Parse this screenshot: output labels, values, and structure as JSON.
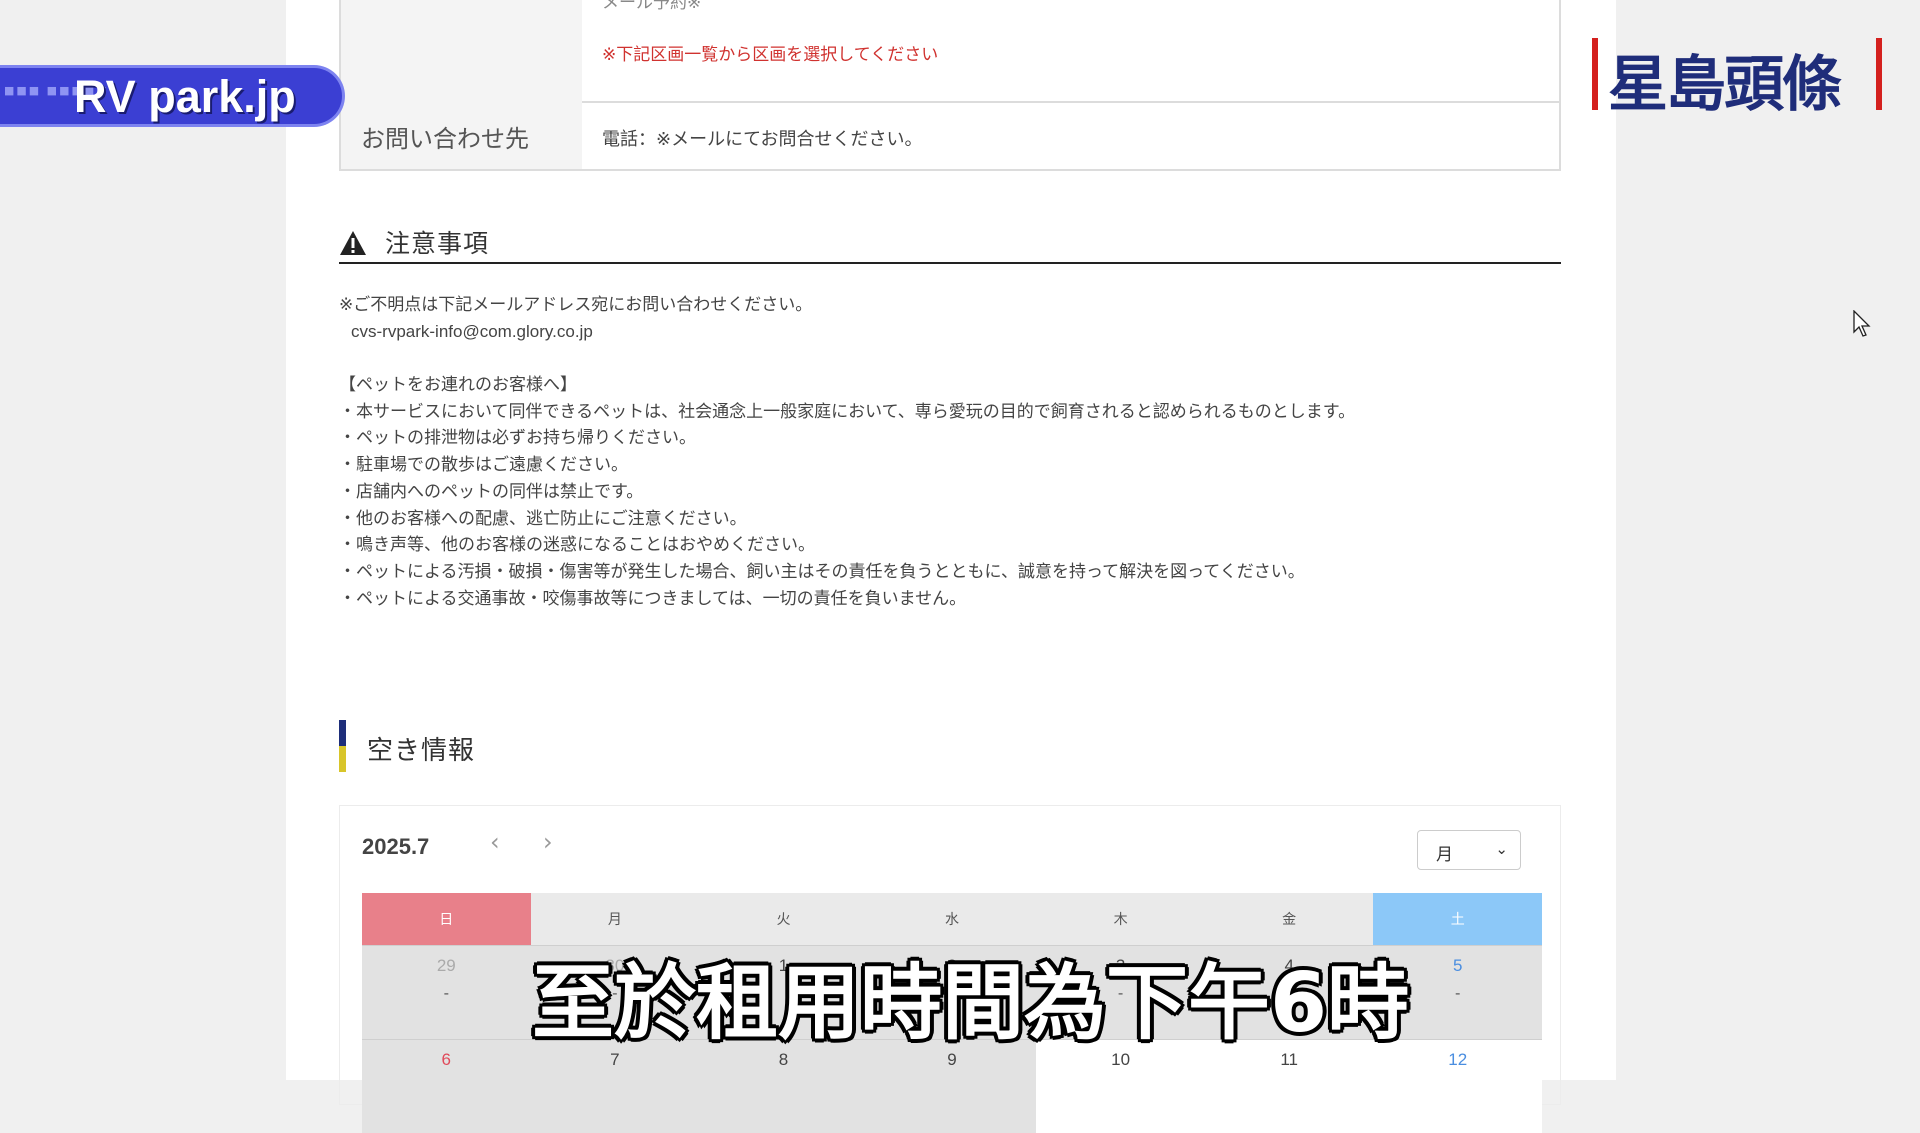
{
  "contact_table": {
    "row1_faded_text": "メール予約※",
    "row1_note": "※下記区画一覧から区画を選択してください",
    "row2_label": "お問い合わせ先",
    "row2_value": "電話：※メールにてお問合せください。"
  },
  "notes": {
    "title": "注意事項",
    "icon": "warning-triangle-icon",
    "inquiry_line": "※ご不明点は下記メールアドレス宛にお問い合わせください。",
    "email": "cvs-rvpark-info@com.glory.co.jp",
    "pet_heading": "【ペットをお連れのお客様へ】",
    "pet_rules": [
      "・本サービスにおいて同伴できるペットは、社会通念上一般家庭において、専ら愛玩の目的で飼育されると認められるものとします。",
      "・ペットの排泄物は必ずお持ち帰りください。",
      "・駐車場での散歩はご遠慮ください。",
      "・店舗内へのペットの同伴は禁止です。",
      "・他のお客様への配慮、逃亡防止にご注意ください。",
      "・鳴き声等、他のお客様の迷惑になることはおやめください。",
      "・ペットによる汚損・破損・傷害等が発生した場合、飼い主はその責任を負うとともに、誠意を持って解決を図ってください。",
      "・ペットによる交通事故・咬傷事故等につきましては、一切の責任を負いません。"
    ]
  },
  "availability": {
    "title": "空き情報",
    "month_label": "2025.7",
    "prev_icon": "chevron-left-icon",
    "next_icon": "chevron-right-icon",
    "prev_glyph": "‹",
    "next_glyph": "›",
    "view_select_value": "月",
    "view_select_chevron": "⌄",
    "weekdays": [
      "日",
      "月",
      "火",
      "水",
      "木",
      "金",
      "土"
    ],
    "week1": [
      {
        "num": "29",
        "status": "-"
      },
      {
        "num": "30",
        "status": "-"
      },
      {
        "num": "1",
        "status": ""
      },
      {
        "num": "2",
        "status": ""
      },
      {
        "num": "3",
        "status": "-"
      },
      {
        "num": "4",
        "status": ""
      },
      {
        "num": "5",
        "status": "-"
      }
    ],
    "week2": [
      {
        "num": "6",
        "status": ""
      },
      {
        "num": "7",
        "status": ""
      },
      {
        "num": "8",
        "status": ""
      },
      {
        "num": "9",
        "status": ""
      },
      {
        "num": "10",
        "status": ""
      },
      {
        "num": "11",
        "status": ""
      },
      {
        "num": "12",
        "status": ""
      }
    ]
  },
  "overlays": {
    "channel_tag": "RV park.jp",
    "channel_dots": "■■■ ■■■■■",
    "logo_text": "星島頭條",
    "subtitle": "至於租用時間為下午6時"
  },
  "colors": {
    "sunday": "#e8808a",
    "saturday": "#8cc8f8",
    "note_red": "#d0322f",
    "logo_blue": "#1f2d7a",
    "logo_red": "#d4201e"
  }
}
